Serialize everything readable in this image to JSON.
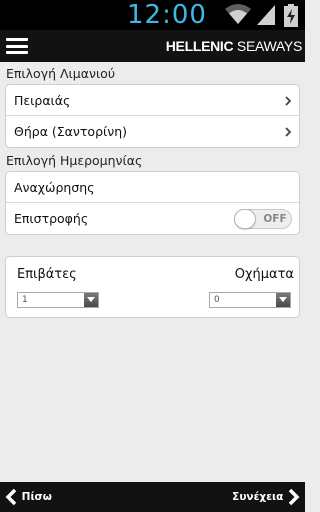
{
  "status_bar": {
    "time": "12:00",
    "icons": [
      "wifi-icon",
      "signal-icon",
      "battery-charging-icon"
    ]
  },
  "app_bar": {
    "menu_icon": "menu-icon",
    "brand_bold": "HELLENIC",
    "brand_light": " SEAWAYS"
  },
  "port_section": {
    "label": "Επιλογή Λιμανιού",
    "rows": [
      {
        "label": "Πειραιάς"
      },
      {
        "label": "Θήρα (Σαντορίνη)"
      }
    ]
  },
  "date_section": {
    "label": "Επιλογή Ημερομηνίας",
    "departure_label": "Αναχώρησης",
    "return_label": "Επιστροφής",
    "return_toggle": {
      "state": "OFF"
    }
  },
  "counts": {
    "passengers_label": "Επιβάτες",
    "passengers_value": "1",
    "vehicles_label": "Οχήματα",
    "vehicles_value": "0"
  },
  "bottom_bar": {
    "back_label": "Πίσω",
    "next_label": "Συνέχεια"
  },
  "colors": {
    "status_time": "#3fb8e6",
    "bars": "#121212",
    "background": "#ececec"
  }
}
